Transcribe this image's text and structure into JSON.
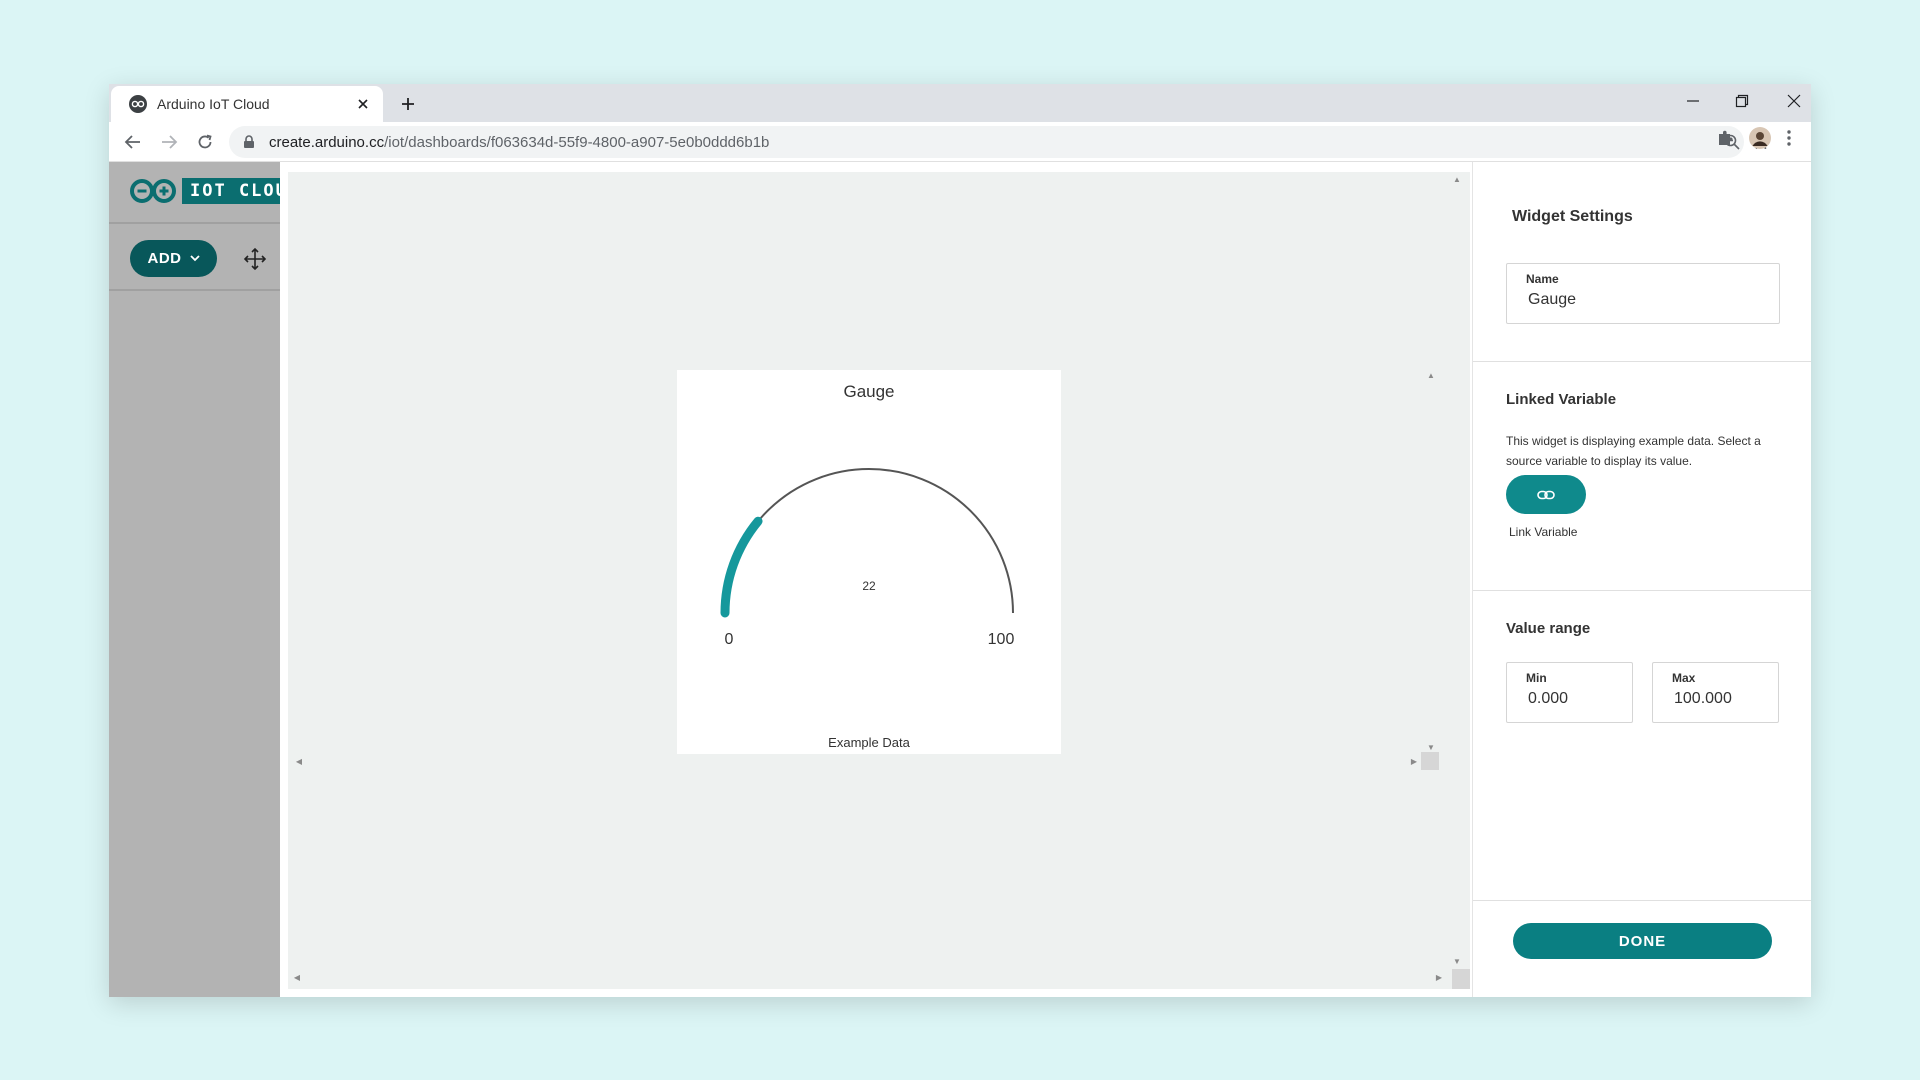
{
  "browser": {
    "tab_title": "Arduino IoT Cloud",
    "url_host": "create.arduino.cc",
    "url_path": "/iot/dashboards/f063634d-55f9-4800-a907-5e0b0ddd6b1b"
  },
  "sidebar": {
    "logo_text": "IOT CLOUD",
    "add_label": "ADD"
  },
  "widget": {
    "title": "Gauge",
    "value_label": "22",
    "value_fraction": 0.22,
    "min_label": "0",
    "max_label": "100",
    "footer": "Example Data",
    "accent_color": "#15989c"
  },
  "settings": {
    "title": "Widget Settings",
    "name_label": "Name",
    "name_value": "Gauge",
    "linked_title": "Linked Variable",
    "linked_help": "This widget is displaying example data. Select a source variable to display its value.",
    "link_label": "Link Variable",
    "range_title": "Value range",
    "min_label": "Min",
    "min_value": "0.000",
    "max_label": "Max",
    "max_value": "100.000",
    "done_label": "DONE"
  },
  "colors": {
    "teal_dark": "#08575a",
    "teal": "#0f8a8c",
    "sidebar_gray": "#b3b3b3",
    "canvas_bg": "#eef1f0",
    "page_bg": "#dbf5f5"
  }
}
